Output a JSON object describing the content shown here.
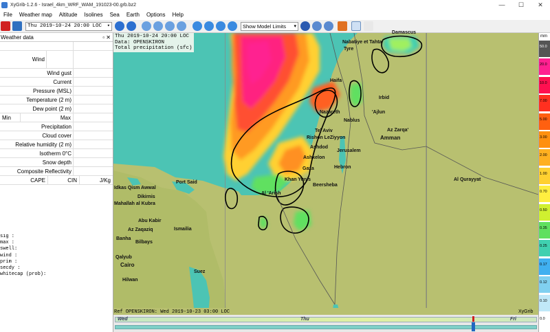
{
  "window": {
    "title": "XyGrib-1.2.6 - Israel_4km_WRF_WAM_191023-00.grb.bz2",
    "minimize": "—",
    "maximize": "☐",
    "close": "✕"
  },
  "menu": [
    "File",
    "Weather map",
    "Altitude",
    "Isolines",
    "Sea",
    "Earth",
    "Options",
    "Help"
  ],
  "toolbar": {
    "date_value": "Thu 2019-10-24 20:00 LOC",
    "limits_value": "Show Model Limits",
    "dropdown_arrow": "▾"
  },
  "panel": {
    "title": "Weather data",
    "controls": "▫ ✕",
    "rows": {
      "wind": "Wind",
      "wind_gust": "Wind gust",
      "current": "Current",
      "pressure": "Pressure (MSL)",
      "temperature": "Temperature (2 m)",
      "dew_point": "Dew point (2 m)",
      "min": "Min",
      "max": "Max",
      "precipitation": "Precipitation",
      "cloud_cover": "Cloud cover",
      "humidity": "Relative humidity (2 m)",
      "isotherm": "Isotherm 0°C",
      "snow": "Snow depth",
      "reflectivity": "Composite Reflectivity",
      "cape": "CAPE",
      "cin": "CIN",
      "unit": "J/Kg"
    },
    "info_lines": [
      "sig  :",
      "max  :",
      "swell:",
      "wind :",
      "prim :",
      "secdy :",
      "whitecap (prob):"
    ]
  },
  "map": {
    "header_lines": [
      "Thu 2019-10-24 20:00 LOC",
      "Data: OPENSKIRON",
      "Total precipitation (sfc)"
    ],
    "ref": "Ref OPENSKIRON: Wed 2019-10-23 03:00 LOC",
    "brand": "XyGrib",
    "cities": {
      "damascus": "Damascus",
      "nabatiye": "Nabatiye et Tahta",
      "tyre": "Tyre",
      "haifa": "Haifa",
      "irbid": "Irbid",
      "nazareth": "Nazareth",
      "ajlun": "'Ajlun",
      "nablus": "Nablus",
      "zarqa": "Az Zarqa'",
      "telaviv": "Tel Aviv",
      "amman": "Amman",
      "rishon": "Rishon LeZiyyon",
      "ashdod": "Ashdod",
      "jerusalem": "Jerusalem",
      "ashkelon": "Ashkelon",
      "hebron": "Hebron",
      "gaza": "Gaza",
      "khanyunis": "Khan Yunis",
      "beersheba": "Beersheba",
      "qurayyat": "Al Qurayyat",
      "portsaid": "Port Said",
      "arish": "Al 'Arish",
      "qism": "Idkas Qism Awwal",
      "dikirnis": "Dikirnis",
      "kubra": "Mahallah al Kubra",
      "kabir": "Abu Kabir",
      "zaqaziq": "Az Zaqaziq",
      "ismailia": "Ismailia",
      "banha": "Banha",
      "bilbays": "Bilbays",
      "qalyub": "Qalyub",
      "cairo": "Cairo",
      "hilwan": "Hilwan",
      "suez": "Suez"
    }
  },
  "timeline": {
    "wed": "Wed",
    "thu": "Thu",
    "fri": "Fri",
    "position_fraction": 0.85
  },
  "legend": {
    "unit": "mm",
    "values": [
      "50.0",
      "20.0",
      "10.0",
      "7.00",
      "5.00",
      "3.00",
      "2.00",
      "1.00",
      "0.70",
      "0.50",
      "0.35",
      "0.25",
      "0.17",
      "0.12",
      "0.10",
      "0.0"
    ],
    "colors": [
      "#555555",
      "#ff2090",
      "#ff1050",
      "#ff3020",
      "#ff6010",
      "#ff9010",
      "#ffb020",
      "#ffd030",
      "#ffee40",
      "#d0f030",
      "#60e060",
      "#40d0b0",
      "#40b0f0",
      "#80d0f0",
      "#c0e8f8",
      "#ffffff"
    ]
  },
  "colors": {
    "sea": "#4cc4b4",
    "land": "#b8c070",
    "precip_land": "#a8c46c"
  }
}
